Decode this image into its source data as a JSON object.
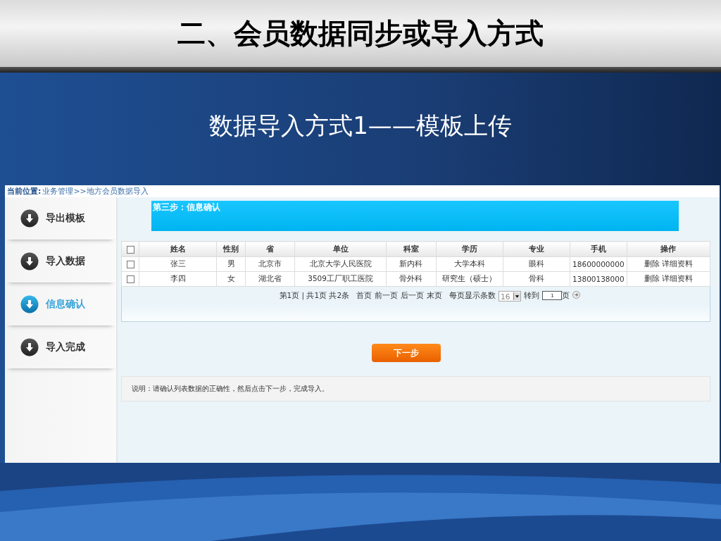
{
  "slide": {
    "title": "二、会员数据同步或导入方式",
    "subtitle": "数据导入方式1——模板上传"
  },
  "screen": {
    "breadcrumb": {
      "label": "当前位置:",
      "path": "业务管理>>地方会员数据导入"
    },
    "steps": [
      {
        "label": "导出模板",
        "selected": false
      },
      {
        "label": "导入数据",
        "selected": false
      },
      {
        "label": "信息确认",
        "selected": true
      },
      {
        "label": "导入完成",
        "selected": false
      }
    ],
    "banner": "第三步：信息确认",
    "table": {
      "header_checked": false,
      "columns": [
        "姓名",
        "性别",
        "省",
        "单位",
        "科室",
        "学历",
        "专业",
        "手机",
        "操作"
      ],
      "rows": [
        {
          "checked": false,
          "cells": [
            "张三",
            "男",
            "北京市",
            "北京大学人民医院",
            "新内科",
            "大学本科",
            "眼科",
            "18600000000"
          ],
          "actions": [
            "删除",
            "详细资料"
          ]
        },
        {
          "checked": false,
          "cells": [
            "李四",
            "女",
            "湖北省",
            "3509工厂职工医院",
            "骨外科",
            "研究生（硕士）",
            "骨科",
            "13800138000"
          ],
          "actions": [
            "删除",
            "详细资料"
          ]
        }
      ]
    },
    "pagination": {
      "summary": "第1页 | 共1页 共2条",
      "links": [
        "首页",
        "前一页",
        "后一页",
        "末页"
      ],
      "page_size_label": "每页显示条数",
      "page_size": "16",
      "goto_label": "转到",
      "goto_page": "1",
      "page_suffix": "页"
    },
    "next_button": "下一步",
    "note": "说明：请确认列表数据的正确性，然后点击下一步，完成导入。"
  }
}
